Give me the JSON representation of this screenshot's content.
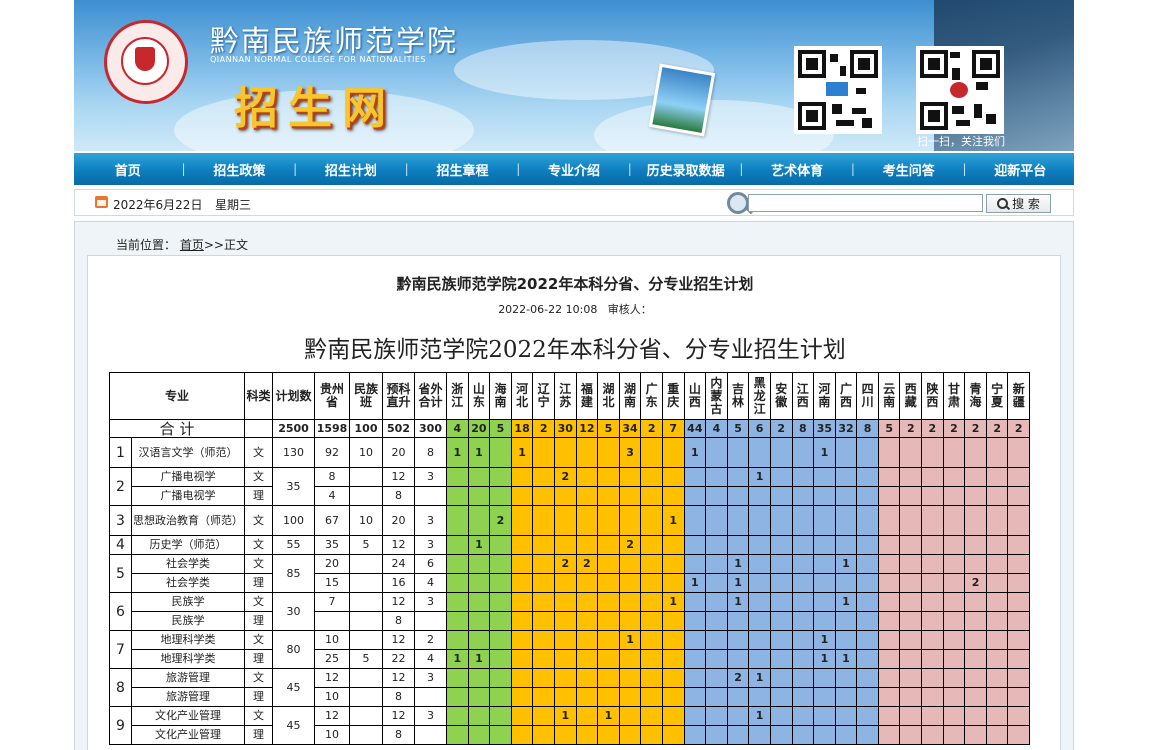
{
  "header": {
    "school_name": "黔南民族师范学院",
    "school_name_en": "QIANNAN NORMAL COLLEGE FOR NATIONALITIES",
    "site_name": "招生网",
    "scan_text": "扫一扫，关注我们"
  },
  "nav": {
    "items": [
      "首页",
      "招生政策",
      "招生计划",
      "招生章程",
      "专业介绍",
      "历史录取数据",
      "艺术体育",
      "考生问答",
      "迎新平台"
    ]
  },
  "toolbar": {
    "date": "2022年6月22日",
    "weekday": "星期三",
    "search_placeholder": "",
    "search_label": "搜 索"
  },
  "breadcrumb": {
    "prefix": "当前位置：",
    "home": "首页",
    "sep": ">>",
    "current": "正文"
  },
  "article": {
    "title": "黔南民族师范学院2022年本科分省、分专业招生计划",
    "meta": "2022-06-22 10:08   审核人：",
    "doc_title": "黔南民族师范学院2022年本科分省、分专业招生计划"
  },
  "table": {
    "headers": {
      "major": "专业",
      "category": "科类",
      "plan": "计划数",
      "guizhou": "贵州省",
      "minzu": "民族班",
      "yuke": "预科直升",
      "outside": "省外合计",
      "provinces": [
        "浙江",
        "山东",
        "海南",
        "河北",
        "辽宁",
        "江苏",
        "福建",
        "湖北",
        "湖南",
        "广东",
        "重庆",
        "山西",
        "内蒙古",
        "吉林",
        "黑龙江",
        "安徽",
        "江西",
        "河南",
        "广西",
        "四川",
        "云南",
        "西藏",
        "陕西",
        "甘肃",
        "青海",
        "宁夏",
        "新疆"
      ],
      "province_groups": [
        "g",
        "g",
        "g",
        "o",
        "o",
        "o",
        "o",
        "o",
        "o",
        "o",
        "o",
        "b",
        "b",
        "b",
        "b",
        "b",
        "b",
        "b",
        "b",
        "b",
        "p",
        "p",
        "p",
        "p",
        "p",
        "p",
        "p"
      ]
    },
    "total": {
      "label": "合  计",
      "plan": "2500",
      "guizhou": "1598",
      "minzu": "100",
      "yuke": "502",
      "outside": "300",
      "provinces": [
        "4",
        "20",
        "5",
        "18",
        "2",
        "30",
        "12",
        "5",
        "34",
        "2",
        "7",
        "44",
        "4",
        "5",
        "6",
        "2",
        "8",
        "35",
        "32",
        "8",
        "5",
        "2",
        "2",
        "2",
        "2",
        "2",
        "2"
      ]
    },
    "groups": [
      {
        "no": "1",
        "plan": "130",
        "rows": [
          {
            "major": "汉语言文学（师范）",
            "cat": "文",
            "guizhou": "92",
            "minzu": "10",
            "yuke": "20",
            "outside": "8",
            "p": [
              "1",
              "1",
              "",
              "1",
              "",
              "",
              "",
              "",
              "3",
              "",
              "",
              "1",
              "",
              "",
              "",
              "",
              "",
              "1",
              "",
              "",
              "",
              "",
              "",
              "",
              "",
              "",
              ""
            ]
          }
        ]
      },
      {
        "no": "2",
        "plan": "35",
        "rows": [
          {
            "major": "广播电视学",
            "cat": "文",
            "guizhou": "8",
            "minzu": "",
            "yuke": "12",
            "outside": "3",
            "p": [
              "",
              "",
              "",
              "",
              "",
              "2",
              "",
              "",
              "",
              "",
              "",
              "",
              "",
              "",
              "1",
              "",
              "",
              "",
              "",
              "",
              "",
              "",
              "",
              "",
              "",
              "",
              ""
            ]
          },
          {
            "major": "广播电视学",
            "cat": "理",
            "guizhou": "4",
            "minzu": "",
            "yuke": "8",
            "outside": "",
            "p": [
              "",
              "",
              "",
              "",
              "",
              "",
              "",
              "",
              "",
              "",
              "",
              "",
              "",
              "",
              "",
              "",
              "",
              "",
              "",
              "",
              "",
              "",
              "",
              "",
              "",
              "",
              ""
            ]
          }
        ]
      },
      {
        "no": "3",
        "plan": "100",
        "rows": [
          {
            "major": "思想政治教育（师范）",
            "cat": "文",
            "guizhou": "67",
            "minzu": "10",
            "yuke": "20",
            "outside": "3",
            "p": [
              "",
              "",
              "2",
              "",
              "",
              "",
              "",
              "",
              "",
              "",
              "1",
              "",
              "",
              "",
              "",
              "",
              "",
              "",
              "",
              "",
              "",
              "",
              "",
              "",
              "",
              "",
              ""
            ]
          }
        ]
      },
      {
        "no": "4",
        "plan": "55",
        "rows": [
          {
            "major": "历史学（师范）",
            "cat": "文",
            "guizhou": "35",
            "minzu": "5",
            "yuke": "12",
            "outside": "3",
            "p": [
              "",
              "1",
              "",
              "",
              "",
              "",
              "",
              "",
              "2",
              "",
              "",
              "",
              "",
              "",
              "",
              "",
              "",
              "",
              "",
              "",
              "",
              "",
              "",
              "",
              "",
              "",
              ""
            ]
          }
        ]
      },
      {
        "no": "5",
        "plan": "85",
        "rows": [
          {
            "major": "社会学类",
            "cat": "文",
            "guizhou": "20",
            "minzu": "",
            "yuke": "24",
            "outside": "6",
            "p": [
              "",
              "",
              "",
              "",
              "",
              "2",
              "2",
              "",
              "",
              "",
              "",
              "",
              "",
              "1",
              "",
              "",
              "",
              "",
              "1",
              "",
              "",
              "",
              "",
              "",
              "",
              "",
              ""
            ]
          },
          {
            "major": "社会学类",
            "cat": "理",
            "guizhou": "15",
            "minzu": "",
            "yuke": "16",
            "outside": "4",
            "p": [
              "",
              "",
              "",
              "",
              "",
              "",
              "",
              "",
              "",
              "",
              "",
              "1",
              "",
              "1",
              "",
              "",
              "",
              "",
              "",
              "",
              "",
              "",
              "",
              "",
              "2",
              "",
              ""
            ]
          }
        ]
      },
      {
        "no": "6",
        "plan": "30",
        "rows": [
          {
            "major": "民族学",
            "cat": "文",
            "guizhou": "7",
            "minzu": "",
            "yuke": "12",
            "outside": "3",
            "p": [
              "",
              "",
              "",
              "",
              "",
              "",
              "",
              "",
              "",
              "",
              "1",
              "",
              "",
              "1",
              "",
              "",
              "",
              "",
              "1",
              "",
              "",
              "",
              "",
              "",
              "",
              "",
              ""
            ]
          },
          {
            "major": "民族学",
            "cat": "理",
            "guizhou": "",
            "minzu": "",
            "yuke": "8",
            "outside": "",
            "p": [
              "",
              "",
              "",
              "",
              "",
              "",
              "",
              "",
              "",
              "",
              "",
              "",
              "",
              "",
              "",
              "",
              "",
              "",
              "",
              "",
              "",
              "",
              "",
              "",
              "",
              "",
              ""
            ]
          }
        ]
      },
      {
        "no": "7",
        "plan": "80",
        "rows": [
          {
            "major": "地理科学类",
            "cat": "文",
            "guizhou": "10",
            "minzu": "",
            "yuke": "12",
            "outside": "2",
            "p": [
              "",
              "",
              "",
              "",
              "",
              "",
              "",
              "",
              "1",
              "",
              "",
              "",
              "",
              "",
              "",
              "",
              "",
              "1",
              "",
              "",
              "",
              "",
              "",
              "",
              "",
              "",
              ""
            ]
          },
          {
            "major": "地理科学类",
            "cat": "理",
            "guizhou": "25",
            "minzu": "5",
            "yuke": "22",
            "outside": "4",
            "p": [
              "1",
              "1",
              "",
              "",
              "",
              "",
              "",
              "",
              "",
              "",
              "",
              "",
              "",
              "",
              "",
              "",
              "",
              "1",
              "1",
              "",
              "",
              "",
              "",
              "",
              "",
              "",
              ""
            ]
          }
        ]
      },
      {
        "no": "8",
        "plan": "45",
        "rows": [
          {
            "major": "旅游管理",
            "cat": "文",
            "guizhou": "12",
            "minzu": "",
            "yuke": "12",
            "outside": "3",
            "p": [
              "",
              "",
              "",
              "",
              "",
              "",
              "",
              "",
              "",
              "",
              "",
              "",
              "",
              "2",
              "1",
              "",
              "",
              "",
              "",
              "",
              "",
              "",
              "",
              "",
              "",
              "",
              ""
            ]
          },
          {
            "major": "旅游管理",
            "cat": "理",
            "guizhou": "10",
            "minzu": "",
            "yuke": "8",
            "outside": "",
            "p": [
              "",
              "",
              "",
              "",
              "",
              "",
              "",
              "",
              "",
              "",
              "",
              "",
              "",
              "",
              "",
              "",
              "",
              "",
              "",
              "",
              "",
              "",
              "",
              "",
              "",
              "",
              ""
            ]
          }
        ]
      },
      {
        "no": "9",
        "plan": "45",
        "rows": [
          {
            "major": "文化产业管理",
            "cat": "文",
            "guizhou": "12",
            "minzu": "",
            "yuke": "12",
            "outside": "3",
            "p": [
              "",
              "",
              "",
              "",
              "",
              "1",
              "",
              "1",
              "",
              "",
              "",
              "",
              "",
              "",
              "1",
              "",
              "",
              "",
              "",
              "",
              "",
              "",
              "",
              "",
              "",
              "",
              ""
            ]
          },
          {
            "major": "文化产业管理",
            "cat": "理",
            "guizhou": "10",
            "minzu": "",
            "yuke": "8",
            "outside": "",
            "p": [
              "",
              "",
              "",
              "",
              "",
              "",
              "",
              "",
              "",
              "",
              "",
              "",
              "",
              "",
              "",
              "",
              "",
              "",
              "",
              "",
              "",
              "",
              "",
              "",
              "",
              "",
              ""
            ]
          }
        ]
      }
    ]
  }
}
